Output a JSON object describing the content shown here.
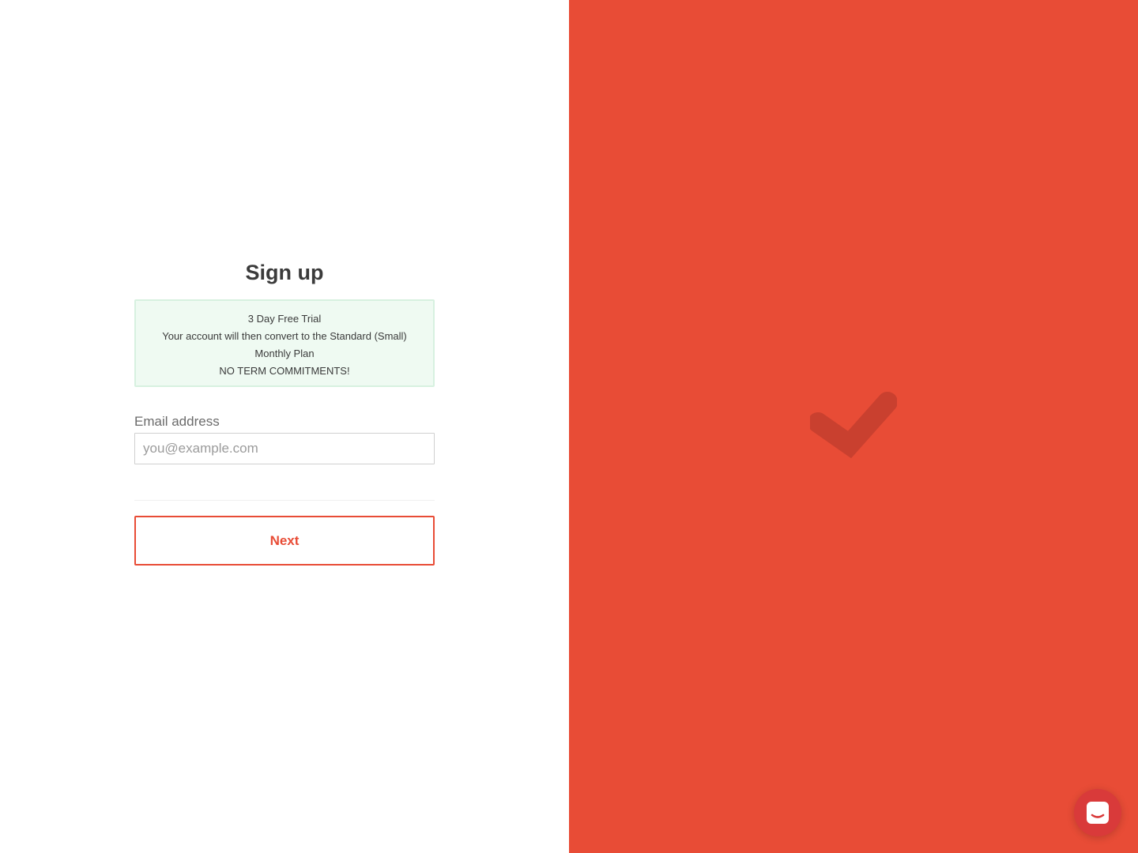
{
  "signup": {
    "title": "Sign up",
    "info": {
      "line1": "3 Day Free Trial",
      "line2": "Your account will then convert to the Standard (Small)",
      "line3": "Monthly Plan",
      "line4": "NO TERM COMMITMENTS!"
    },
    "email_label": "Email address",
    "email_placeholder": "you@example.com",
    "email_value": "",
    "next_label": "Next"
  },
  "icons": {
    "hero": "checkmark-icon",
    "chat": "chat-icon"
  },
  "colors": {
    "accent": "#e84c36",
    "checkmark": "#c9402f",
    "info_bg": "#effaf2",
    "info_border": "#d7f1e0",
    "chat_launcher": "#d93a3a"
  }
}
